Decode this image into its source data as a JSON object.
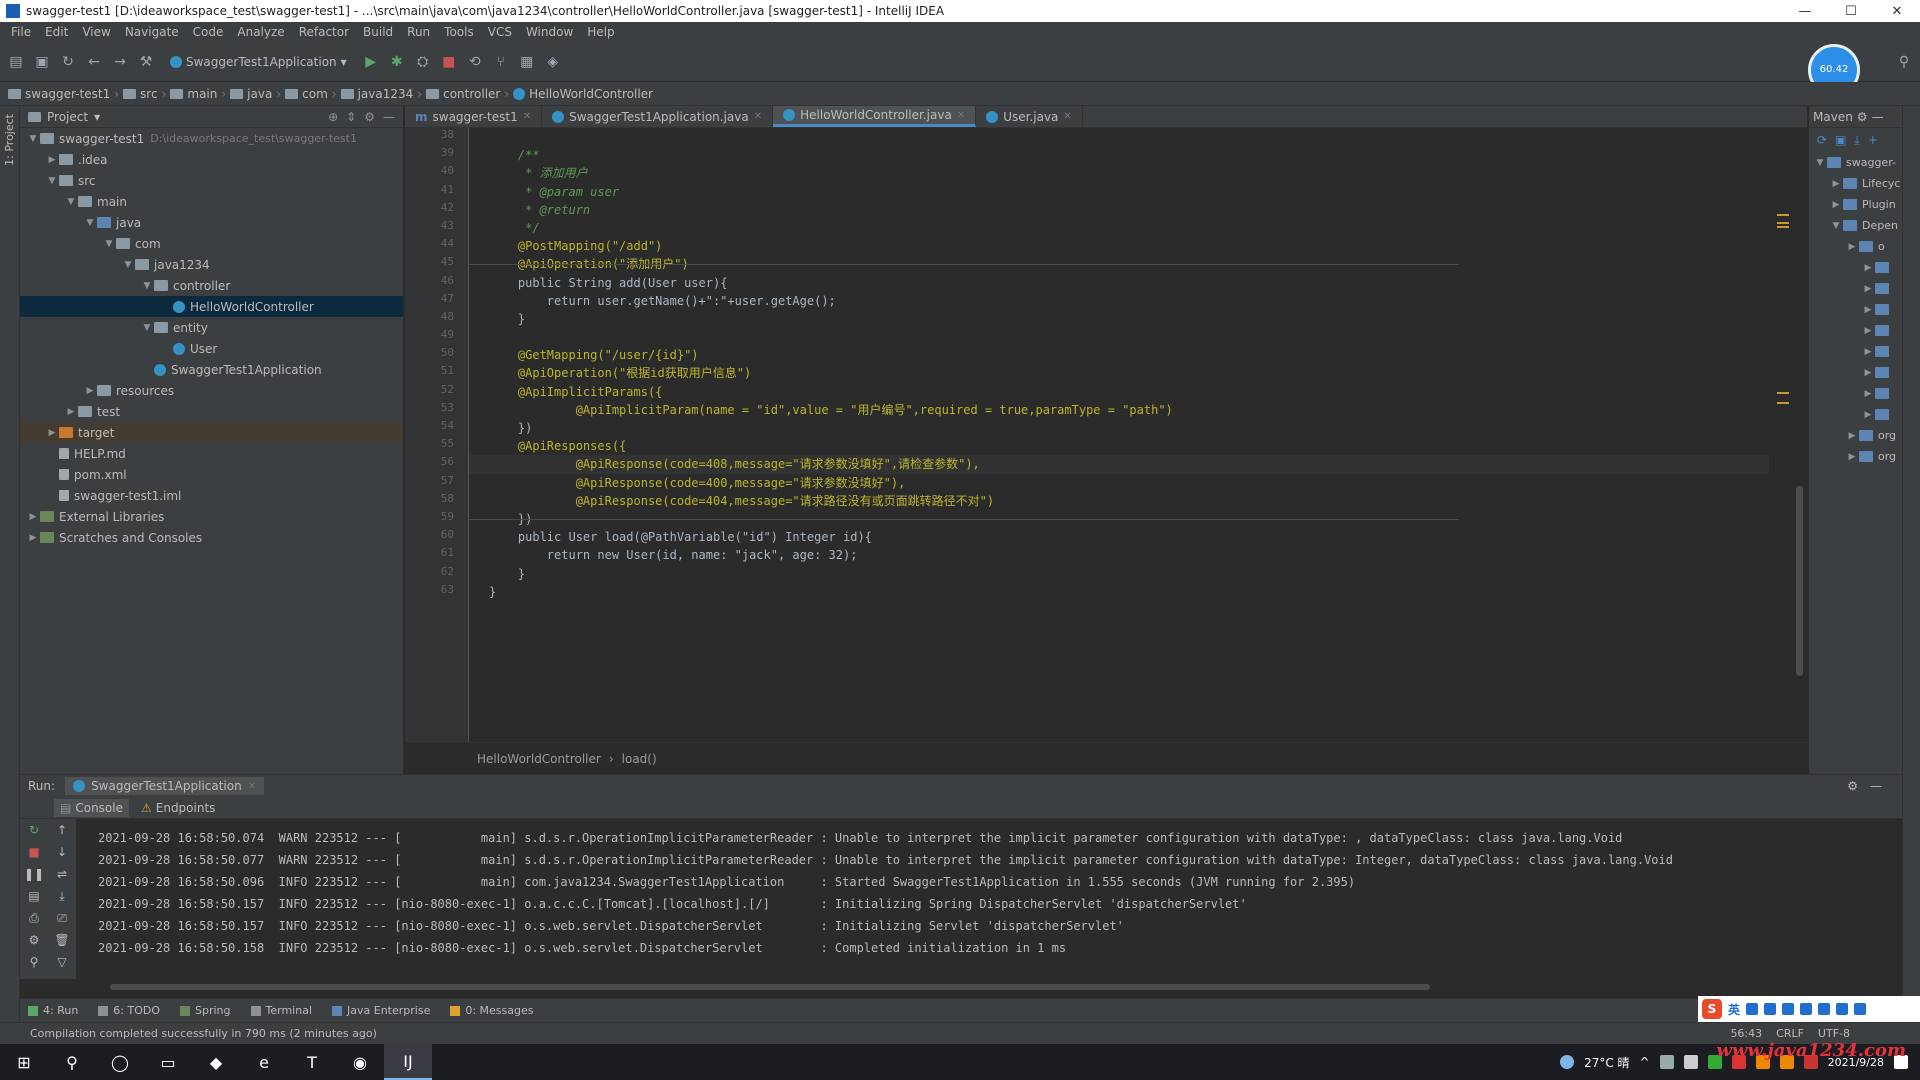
{
  "window": {
    "title": "swagger-test1 [D:\\ideaworkspace_test\\swagger-test1] - ...\\src\\main\\java\\com\\java1234\\controller\\HelloWorldController.java [swagger-test1] - IntelliJ IDEA",
    "min": "—",
    "max": "☐",
    "close": "✕"
  },
  "menu": [
    "File",
    "Edit",
    "View",
    "Navigate",
    "Code",
    "Analyze",
    "Refactor",
    "Build",
    "Run",
    "Tools",
    "VCS",
    "Window",
    "Help"
  ],
  "toolbar": {
    "run_config": "SwaggerTest1Application",
    "avatar_text": "60.42"
  },
  "navbar": {
    "crumbs": [
      "swagger-test1",
      "src",
      "main",
      "java",
      "com",
      "java1234",
      "controller",
      "HelloWorldController"
    ]
  },
  "left_strip": {
    "label": "1: Project"
  },
  "project": {
    "header": "Project",
    "tree": [
      {
        "label": "swagger-test1",
        "sub": "D:\\ideaworkspace_test\\swagger-test1",
        "indent": 0,
        "arrow": "▼",
        "icon": "folder"
      },
      {
        "label": ".idea",
        "indent": 1,
        "arrow": "▶",
        "icon": "folder"
      },
      {
        "label": "src",
        "indent": 1,
        "arrow": "▼",
        "icon": "folder"
      },
      {
        "label": "main",
        "indent": 2,
        "arrow": "▼",
        "icon": "folder"
      },
      {
        "label": "java",
        "indent": 3,
        "arrow": "▼",
        "icon": "src"
      },
      {
        "label": "com",
        "indent": 4,
        "arrow": "▼",
        "icon": "folder"
      },
      {
        "label": "java1234",
        "indent": 5,
        "arrow": "▼",
        "icon": "folder"
      },
      {
        "label": "controller",
        "indent": 6,
        "arrow": "▼",
        "icon": "folder"
      },
      {
        "label": "HelloWorldController",
        "indent": 7,
        "arrow": "",
        "icon": "class",
        "selected": true
      },
      {
        "label": "entity",
        "indent": 6,
        "arrow": "▼",
        "icon": "folder"
      },
      {
        "label": "User",
        "indent": 7,
        "arrow": "",
        "icon": "class"
      },
      {
        "label": "SwaggerTest1Application",
        "indent": 6,
        "arrow": "",
        "icon": "class"
      },
      {
        "label": "resources",
        "indent": 3,
        "arrow": "▶",
        "icon": "folder"
      },
      {
        "label": "test",
        "indent": 2,
        "arrow": "▶",
        "icon": "folder"
      },
      {
        "label": "target",
        "indent": 1,
        "arrow": "▶",
        "icon": "orange",
        "target": true
      },
      {
        "label": "HELP.md",
        "indent": 1,
        "arrow": "",
        "icon": "file"
      },
      {
        "label": "pom.xml",
        "indent": 1,
        "arrow": "",
        "icon": "file"
      },
      {
        "label": "swagger-test1.iml",
        "indent": 1,
        "arrow": "",
        "icon": "file"
      },
      {
        "label": "External Libraries",
        "indent": 0,
        "arrow": "▶",
        "icon": "lib"
      },
      {
        "label": "Scratches and Consoles",
        "indent": 0,
        "arrow": "▶",
        "icon": "lib"
      }
    ]
  },
  "tabs": [
    {
      "label": "swagger-test1",
      "icon": "m",
      "active": false
    },
    {
      "label": "SwaggerTest1Application.java",
      "icon": "c",
      "active": false
    },
    {
      "label": "HelloWorldController.java",
      "icon": "c",
      "active": true
    },
    {
      "label": "User.java",
      "icon": "c",
      "active": false
    }
  ],
  "editor": {
    "line_numbers": [
      "38",
      "39",
      "40",
      "41",
      "42",
      "43",
      "44",
      "45",
      "46",
      "47",
      "48",
      "49",
      "50",
      "51",
      "52",
      "53",
      "54",
      "55",
      "56",
      "57",
      "58",
      "59",
      "60",
      "61",
      "62",
      "63"
    ],
    "lines": [
      "",
      "    /**",
      "     * 添加用户",
      "     * @param user",
      "     * @return",
      "     */",
      "    @PostMapping(\"/add\")",
      "    @ApiOperation(\"添加用户\")",
      "    public String add(User user){",
      "        return user.getName()+\":\"+user.getAge();",
      "    }",
      "",
      "    @GetMapping(\"/user/{id}\")",
      "    @ApiOperation(\"根据id获取用户信息\")",
      "    @ApiImplicitParams({",
      "            @ApiImplicitParam(name = \"id\",value = \"用户编号\",required = true,paramType = \"path\")",
      "    })",
      "    @ApiResponses({",
      "            @ApiResponse(code=408,message=\"请求参数没填好\",请检查参数\"),",
      "            @ApiResponse(code=400,message=\"请求参数没填好\"),",
      "            @ApiResponse(code=404,message=\"请求路径没有或页面跳转路径不对\")",
      "    })",
      "    public User load(@PathVariable(\"id\") Integer id){",
      "        return new User(id, name: \"jack\", age: 32);",
      "    }",
      "}"
    ],
    "breadcrumb": [
      "HelloWorldController",
      "load()"
    ]
  },
  "maven": {
    "header": "Maven",
    "items": [
      {
        "label": "swagger-",
        "indent": 0
      },
      {
        "label": "Lifecyc",
        "indent": 1
      },
      {
        "label": "Plugin",
        "indent": 1
      },
      {
        "label": "Depen",
        "indent": 1
      },
      {
        "label": "o",
        "indent": 2
      },
      {
        "label": "",
        "indent": 3
      },
      {
        "label": "",
        "indent": 3
      },
      {
        "label": "",
        "indent": 3
      },
      {
        "label": "",
        "indent": 3
      },
      {
        "label": "",
        "indent": 3
      },
      {
        "label": "",
        "indent": 3
      },
      {
        "label": "",
        "indent": 3
      },
      {
        "label": "",
        "indent": 3
      },
      {
        "label": "org",
        "indent": 2
      },
      {
        "label": "org",
        "indent": 2
      }
    ]
  },
  "run": {
    "label": "Run:",
    "config": "SwaggerTest1Application",
    "subtabs": [
      "Console",
      "Endpoints"
    ],
    "log": [
      "2021-09-28 16:58:50.074  WARN 223512 --- [           main] s.d.s.r.OperationImplicitParameterReader : Unable to interpret the implicit parameter configuration with dataType: , dataTypeClass: class java.lang.Void",
      "2021-09-28 16:58:50.077  WARN 223512 --- [           main] s.d.s.r.OperationImplicitParameterReader : Unable to interpret the implicit parameter configuration with dataType: Integer, dataTypeClass: class java.lang.Void",
      "2021-09-28 16:58:50.096  INFO 223512 --- [           main] com.java1234.SwaggerTest1Application     : Started SwaggerTest1Application in 1.555 seconds (JVM running for 2.395)",
      "2021-09-28 16:58:50.157  INFO 223512 --- [nio-8080-exec-1] o.a.c.c.C.[Tomcat].[localhost].[/]       : Initializing Spring DispatcherServlet 'dispatcherServlet'",
      "2021-09-28 16:58:50.157  INFO 223512 --- [nio-8080-exec-1] o.s.web.servlet.DispatcherServlet        : Initializing Servlet 'dispatcherServlet'",
      "2021-09-28 16:58:50.158  INFO 223512 --- [nio-8080-exec-1] o.s.web.servlet.DispatcherServlet        : Completed initialization in 1 ms"
    ]
  },
  "bottom_tools": [
    "4: Run",
    "6: TODO",
    "Spring",
    "Terminal",
    "Java Enterprise",
    "0: Messages"
  ],
  "status": {
    "message": "Compilation completed successfully in 790 ms (2 minutes ago)",
    "right": [
      "56:43",
      "CRLF",
      "UTF-8"
    ]
  },
  "taskbar": {
    "apps": [
      "⊞",
      "⚲",
      "◯",
      "▭",
      "◆",
      "e",
      "T",
      "◉",
      "IJ"
    ],
    "weather": "27°C 晴",
    "time": "2021/9/28",
    "watermark": "www.java1234.com"
  },
  "colors": {
    "accent": "#4a88c7",
    "background": "#2b2b2b",
    "panel": "#3c3f41",
    "selection": "#0d293e"
  }
}
